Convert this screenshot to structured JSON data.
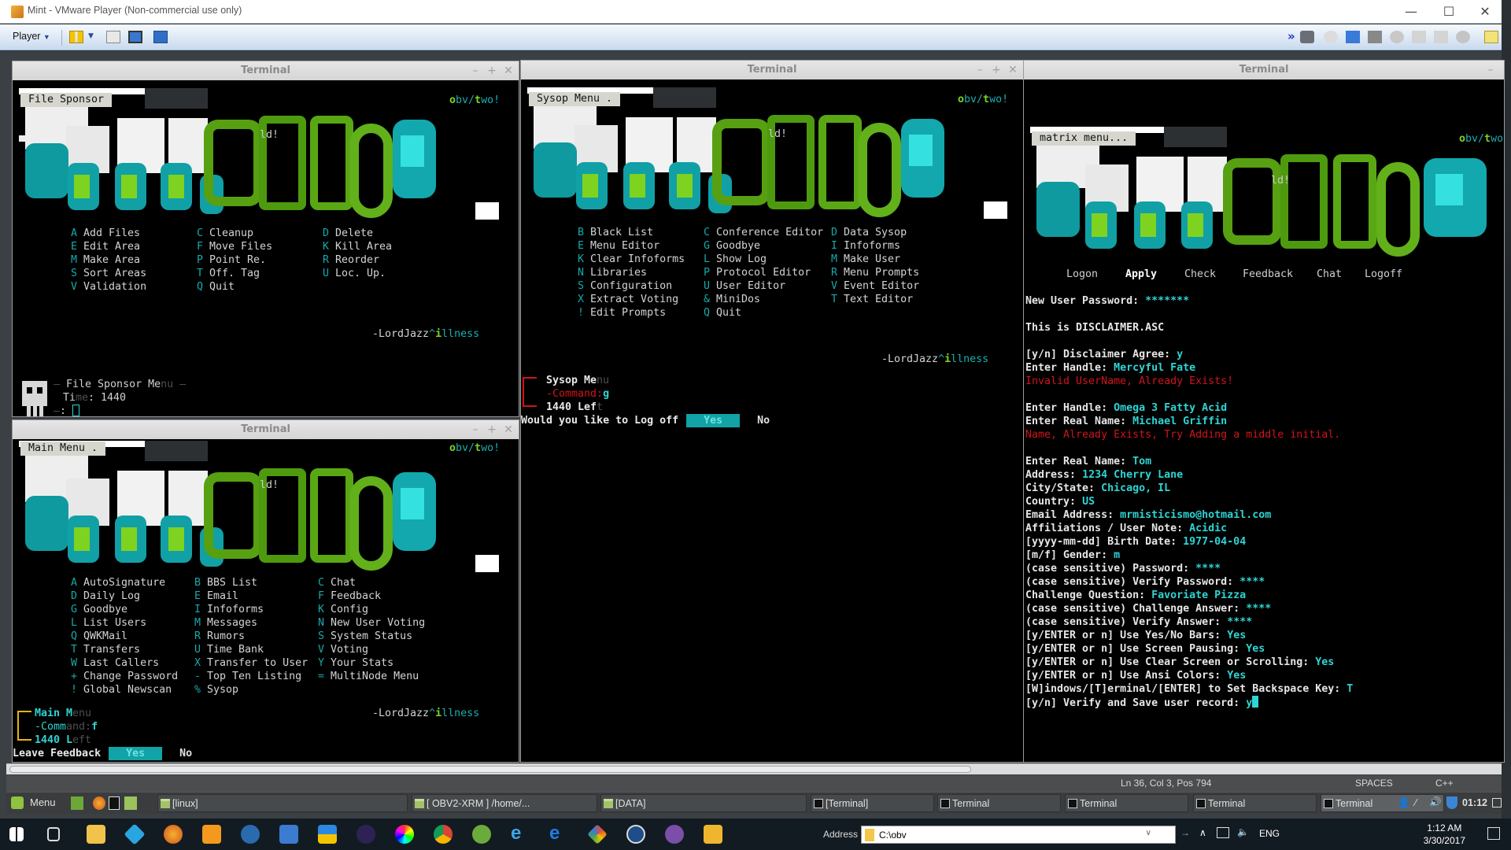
{
  "vmware": {
    "title": "Mint - VMware Player (Non-commercial use only)",
    "player_menu": "Player",
    "controls": {
      "minimize": "—",
      "maximize": "☐",
      "close": "✕"
    }
  },
  "terminals": {
    "file_sponsor": {
      "window_title": "Terminal",
      "menu_label": "File Sponsor",
      "obv_o": "o",
      "obv_mid": "bv/",
      "obv_t": "t",
      "obv_end": "wo!",
      "ld": "ld!",
      "columns": [
        [
          {
            "key": "A",
            "label": "Add Files"
          },
          {
            "key": "E",
            "label": "Edit Area"
          },
          {
            "key": "M",
            "label": "Make Area"
          },
          {
            "key": "S",
            "label": "Sort Areas"
          },
          {
            "key": "V",
            "label": "Validation"
          }
        ],
        [
          {
            "key": "C",
            "label": "Cleanup"
          },
          {
            "key": "F",
            "label": "Move Files"
          },
          {
            "key": "P",
            "label": "Point Re."
          },
          {
            "key": "T",
            "label": "Off. Tag"
          },
          {
            "key": "Q",
            "label": "Quit"
          }
        ],
        [
          {
            "key": "D",
            "label": "Delete"
          },
          {
            "key": "K",
            "label": "Kill Area"
          },
          {
            "key": "R",
            "label": "Reorder"
          },
          {
            "key": "U",
            "label": "Loc. Up."
          }
        ]
      ],
      "signature": {
        "name": "-LordJazz",
        "caret": "^",
        "i": "i",
        "rest": "llness"
      },
      "prompt": {
        "title_a": "File Sponsor Me",
        "title_b": "nu",
        "time_a": "Ti",
        "time_b": "me",
        "time_value": ": 1440",
        "input_prefix": ":"
      }
    },
    "main_menu": {
      "window_title": "Terminal",
      "menu_label": "Main Menu  .",
      "obv_o": "o",
      "obv_mid": "bv/",
      "obv_t": "t",
      "obv_end": "wo!",
      "ld": "ld!",
      "columns": [
        [
          {
            "key": "A",
            "label": "AutoSignature"
          },
          {
            "key": "D",
            "label": "Daily Log"
          },
          {
            "key": "G",
            "label": "Goodbye"
          },
          {
            "key": "L",
            "label": "List Users"
          },
          {
            "key": "Q",
            "label": "QWKMail"
          },
          {
            "key": "T",
            "label": "Transfers"
          },
          {
            "key": "W",
            "label": "Last Callers"
          },
          {
            "key": "+",
            "label": "Change Password"
          },
          {
            "key": "!",
            "label": "Global Newscan"
          }
        ],
        [
          {
            "key": "B",
            "label": "BBS List"
          },
          {
            "key": "E",
            "label": "Email"
          },
          {
            "key": "I",
            "label": "Infoforms"
          },
          {
            "key": "M",
            "label": "Messages"
          },
          {
            "key": "R",
            "label": "Rumors"
          },
          {
            "key": "U",
            "label": "Time Bank"
          },
          {
            "key": "X",
            "label": "Transfer to User"
          },
          {
            "key": "-",
            "label": "Top Ten Listing"
          },
          {
            "key": "%",
            "label": "Sysop"
          }
        ],
        [
          {
            "key": "C",
            "label": "Chat"
          },
          {
            "key": "F",
            "label": "Feedback"
          },
          {
            "key": "K",
            "label": "Config"
          },
          {
            "key": "N",
            "label": "New User Voting"
          },
          {
            "key": "S",
            "label": "System Status"
          },
          {
            "key": "V",
            "label": "Voting"
          },
          {
            "key": "Y",
            "label": "Your Stats"
          },
          {
            "key": "=",
            "label": "MultiNode Menu"
          }
        ]
      ],
      "signature": {
        "name": "-LordJazz",
        "caret": "^",
        "i": "i",
        "rest": "llness"
      },
      "prompt": {
        "title_a": "Main M",
        "title_b": "enu",
        "command_a": "-Comm",
        "command_b": "and:",
        "command_value": "f",
        "left_a": "1440 L",
        "left_b": "eft"
      },
      "question": "Leave Feedback",
      "yes": "Yes",
      "no": "No"
    },
    "sysop_menu": {
      "window_title": "Terminal",
      "menu_label": "Sysop Menu .",
      "obv_o": "o",
      "obv_mid": "bv/",
      "obv_t": "t",
      "obv_end": "wo!",
      "ld": "ld!",
      "columns": [
        [
          {
            "key": "B",
            "label": "Black List"
          },
          {
            "key": "E",
            "label": "Menu Editor"
          },
          {
            "key": "K",
            "label": "Clear Infoforms"
          },
          {
            "key": "N",
            "label": "Libraries"
          },
          {
            "key": "S",
            "label": "Configuration"
          },
          {
            "key": "X",
            "label": "Extract Voting"
          },
          {
            "key": "!",
            "label": "Edit Prompts"
          }
        ],
        [
          {
            "key": "C",
            "label": "Conference Editor"
          },
          {
            "key": "G",
            "label": "Goodbye"
          },
          {
            "key": "L",
            "label": "Show Log"
          },
          {
            "key": "P",
            "label": "Protocol Editor"
          },
          {
            "key": "U",
            "label": "User Editor"
          },
          {
            "key": "&",
            "label": "MiniDos"
          },
          {
            "key": "Q",
            "label": "Quit"
          }
        ],
        [
          {
            "key": "D",
            "label": "Data Sysop"
          },
          {
            "key": "I",
            "label": "Infoforms"
          },
          {
            "key": "M",
            "label": "Make User"
          },
          {
            "key": "R",
            "label": "Menu Prompts"
          },
          {
            "key": "V",
            "label": "Event Editor"
          },
          {
            "key": "T",
            "label": "Text Editor"
          }
        ]
      ],
      "signature": {
        "name": "-LordJazz",
        "caret": "^",
        "i": "i",
        "rest": "llness"
      },
      "prompt": {
        "title_a": "Sysop Me",
        "title_b": "nu",
        "command": "-Command:",
        "command_value": "g",
        "left_a": "1440 Lef",
        "left_b": "t"
      },
      "question": "Would you like to Log off",
      "yes": "Yes",
      "no": "No"
    },
    "matrix": {
      "window_title": "Terminal",
      "menu_label": "matrix menu...",
      "obv_o": "o",
      "obv_mid": "bv/",
      "obv_t": "t",
      "obv_end": "wo",
      "ld": "ld!",
      "nav": [
        "Logon",
        "Apply",
        "Check",
        "Feedback",
        "Chat",
        "Logoff"
      ],
      "nav_active": "Apply",
      "form": [
        {
          "label": "New User Password: ",
          "value": "*******"
        },
        {
          "label": "",
          "value": ""
        },
        {
          "label": "This is DISCLAIMER.ASC",
          "value": ""
        },
        {
          "label": "",
          "value": ""
        },
        {
          "label": "[y/n] Disclaimer Agree: ",
          "value": "y"
        },
        {
          "label": "Enter Handle: ",
          "value": "Mercyful Fate"
        },
        {
          "error": "Invalid UserName, Already Exists!"
        },
        {
          "label": "",
          "value": ""
        },
        {
          "label": "Enter Handle: ",
          "value": "Omega 3 Fatty Acid"
        },
        {
          "label": "Enter Real Name: ",
          "value": "Michael Griffin"
        },
        {
          "error": "Name, Already Exists, Try Adding a middle initial."
        },
        {
          "label": "",
          "value": ""
        },
        {
          "label": "Enter Real Name: ",
          "value": "Tom"
        },
        {
          "label": "Address: ",
          "value": "1234 Cherry Lane"
        },
        {
          "label": "City/State: ",
          "value": "Chicago, IL"
        },
        {
          "label": "Country: ",
          "value": "US"
        },
        {
          "label": "Email Address: ",
          "value": "mrmisticismo@hotmail.com"
        },
        {
          "label": "Affiliations / User Note: ",
          "value": "Acidic"
        },
        {
          "label": "[yyyy-mm-dd] Birth Date: ",
          "value": "1977-04-04"
        },
        {
          "label": "[m/f] Gender: ",
          "value": "m"
        },
        {
          "label": "(case sensitive) Password: ",
          "value": "****"
        },
        {
          "label": "(case sensitive) Verify Password: ",
          "value": "****"
        },
        {
          "label": "Challenge Question: ",
          "value": "Favoriate Pizza"
        },
        {
          "label": "(case sensitive) Challenge Answer: ",
          "value": "****"
        },
        {
          "label": "(case sensitive) Verify Answer: ",
          "value": "****"
        },
        {
          "label": "[y/ENTER or n] Use Yes/No Bars: ",
          "value": "Yes"
        },
        {
          "label": "[y/ENTER or n] Use Screen Pausing: ",
          "value": "Yes"
        },
        {
          "label": "[y/ENTER or n] Use Clear Screen or Scrolling: ",
          "value": "Yes"
        },
        {
          "label": "[y/ENTER or n] Use Ansi Colors: ",
          "value": "Yes"
        },
        {
          "label": "[W]indows/[T]erminal/[ENTER] to Set Backspace Key: ",
          "value": "T"
        },
        {
          "label": "[y/n] Verify and Save user record: ",
          "value": "y",
          "cursor": true
        }
      ]
    }
  },
  "statusbar": {
    "position": "Ln 36, Col 3, Pos 794",
    "indent": "SPACES",
    "language": "C++"
  },
  "mint_panel": {
    "menu_label": "Menu",
    "tasks": [
      {
        "label": "[linux]",
        "icon": "folder-icon",
        "active": false
      },
      {
        "label": "[ OBV2-XRM ] /home/...",
        "icon": "editor-icon",
        "active": false
      },
      {
        "label": "[DATA]",
        "icon": "folder-icon",
        "active": false
      },
      {
        "label": "[Terminal]",
        "icon": "terminal-icon",
        "active": false
      },
      {
        "label": "Terminal",
        "icon": "terminal-icon",
        "active": false
      },
      {
        "label": "Terminal",
        "icon": "terminal-icon",
        "active": false
      },
      {
        "label": "Terminal",
        "icon": "terminal-icon",
        "active": false
      },
      {
        "label": "Terminal",
        "icon": "terminal-icon",
        "active": true
      }
    ],
    "clock": "01:12"
  },
  "windows_taskbar": {
    "address_label": "Address",
    "address_value": "C:\\obv",
    "language": "ENG",
    "time": "1:12 AM",
    "date": "3/30/2017"
  }
}
